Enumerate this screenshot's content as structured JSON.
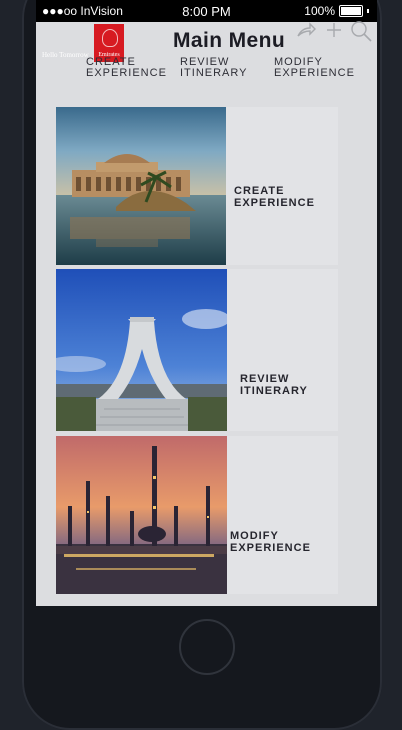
{
  "status_bar": {
    "carrier": "●●●oo InVision",
    "time": "8:00 PM",
    "battery": "100%"
  },
  "header": {
    "logo_tagline": "Hello Tomorrow",
    "logo_text": "Emirates",
    "title": "Main Menu"
  },
  "tabs": [
    {
      "label": "CREATE\nEXPERIENCE"
    },
    {
      "label": "REVIEW\nITINERARY"
    },
    {
      "label": "MODIFY\nEXPERIENCE"
    }
  ],
  "cards": [
    {
      "label": "CREATE EXPERIENCE",
      "image": "palace-on-water"
    },
    {
      "label": "REVIEW ITINERARY",
      "image": "azadi-tower"
    },
    {
      "label": "MODIFY EXPERIENCE",
      "image": "mosque-at-sunset"
    }
  ]
}
